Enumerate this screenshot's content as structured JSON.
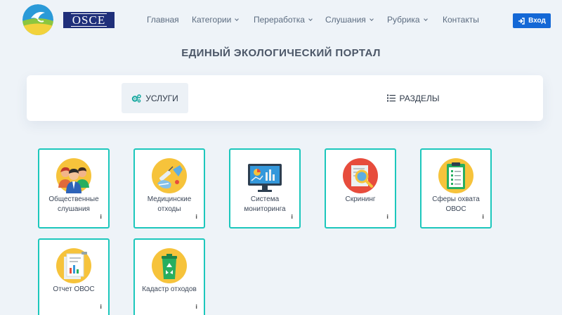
{
  "header": {
    "osce_logo_text": "OSCE",
    "nav": [
      {
        "label": "Главная",
        "dropdown": false
      },
      {
        "label": "Категории",
        "dropdown": true
      },
      {
        "label": "Переработка",
        "dropdown": true
      },
      {
        "label": "Слушания",
        "dropdown": true
      },
      {
        "label": "Рубрика",
        "dropdown": true
      },
      {
        "label": "Контакты",
        "dropdown": false
      }
    ],
    "login_label": "Вход",
    "login_icon": "sign-in-icon"
  },
  "page_title": "ЕДИНЫЙ ЭКОЛОГИЧЕСКИЙ ПОРТАЛ",
  "tabs": [
    {
      "label": "УСЛУГИ",
      "icon": "gears-icon",
      "active": true
    },
    {
      "label": "РАЗДЕЛЫ",
      "icon": "list-icon",
      "active": false
    }
  ],
  "tiles": [
    {
      "label": "Общественные слушания",
      "icon": "people-icon",
      "info": "i"
    },
    {
      "label": "Медицинские отходы",
      "icon": "medical-waste-icon",
      "info": "i"
    },
    {
      "label": "Система мониторинга",
      "icon": "monitor-chart-icon",
      "info": "i"
    },
    {
      "label": "Скрининг",
      "icon": "magnifier-icon",
      "info": "i"
    },
    {
      "label": "Сферы охвата ОВОС",
      "icon": "clipboard-icon",
      "info": "i"
    },
    {
      "label": "Отчет ОВОС",
      "icon": "report-icon",
      "info": "i"
    },
    {
      "label": "Кадастр отходов",
      "icon": "recycle-bin-icon",
      "info": "i"
    }
  ],
  "colors": {
    "accent": "#1468d6",
    "tile_border": "#1cc7bc",
    "background": "#eef3f8",
    "icon_circle": "#f6c33b"
  }
}
